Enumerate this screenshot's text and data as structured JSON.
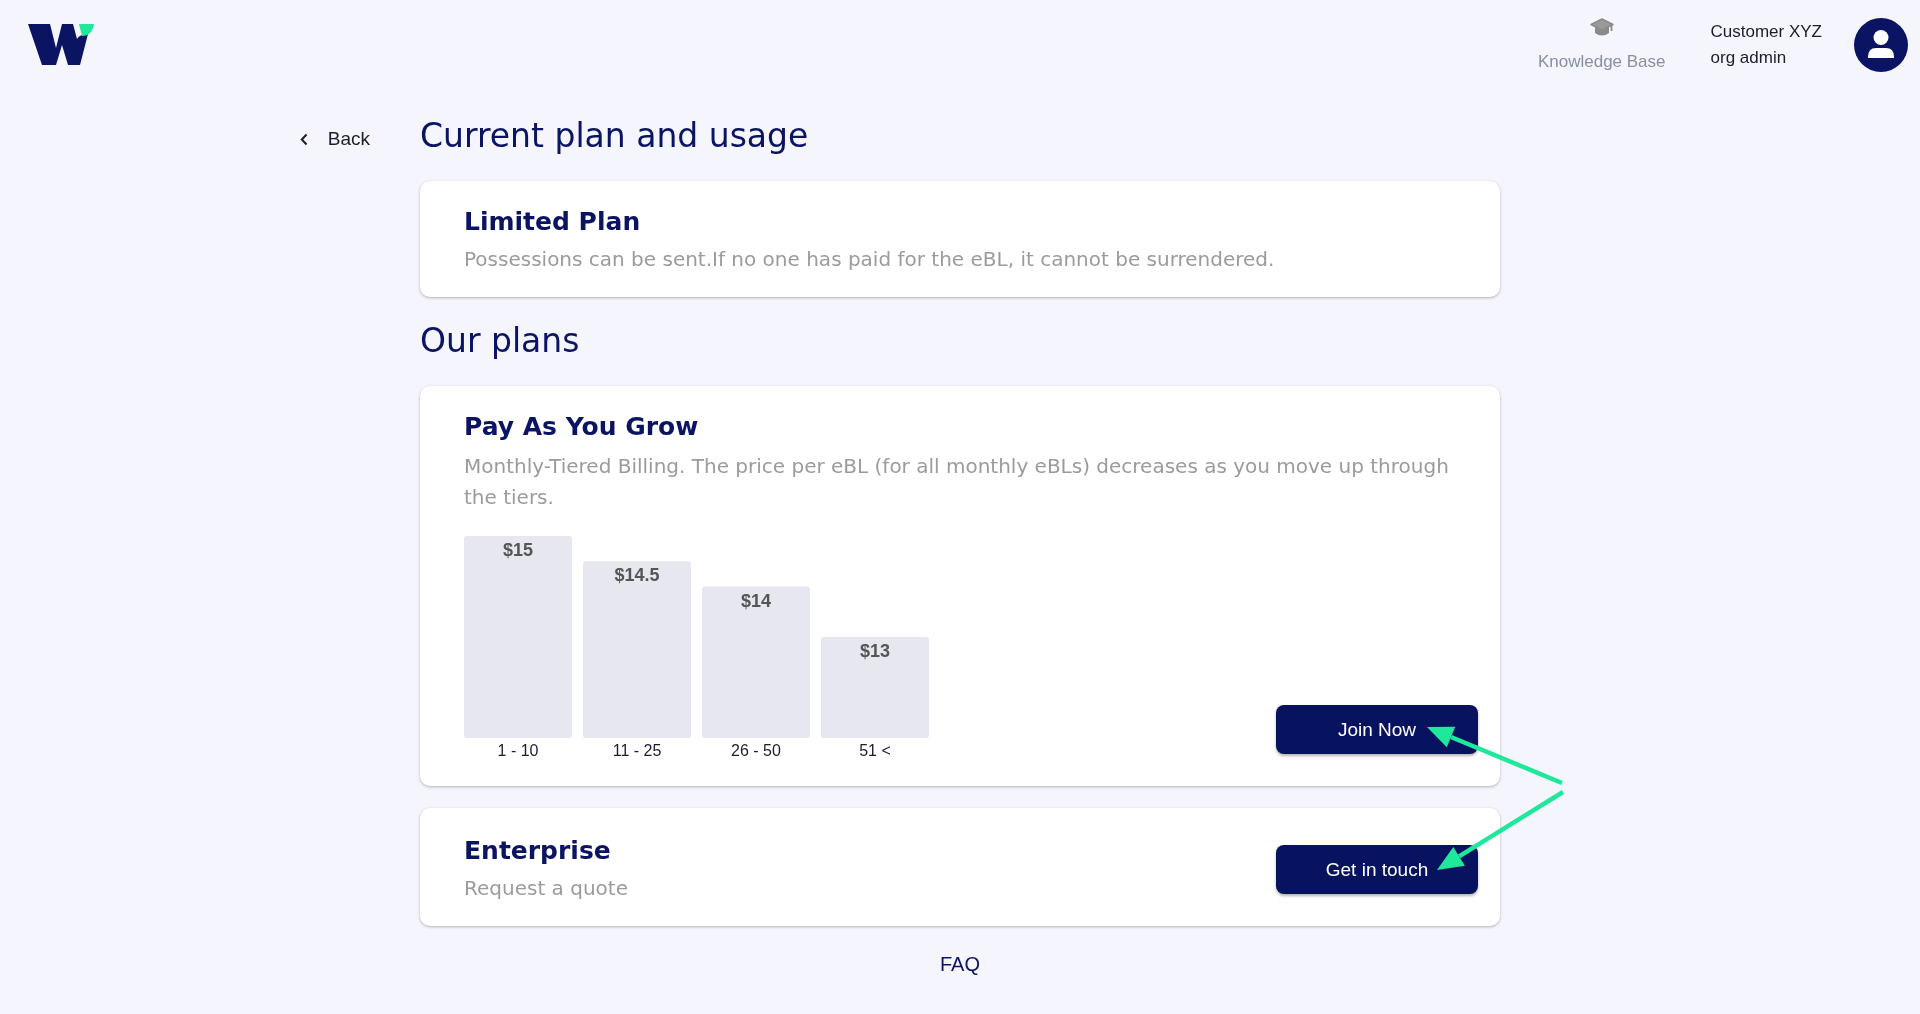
{
  "header": {
    "knowledge_base": {
      "label": "Knowledge Base"
    },
    "user": {
      "name": "Customer XYZ",
      "role": "org admin"
    }
  },
  "back": {
    "label": "Back"
  },
  "page_title": "Current plan and usage",
  "current_plan": {
    "title": "Limited Plan",
    "description": "Possessions can be sent.If no one has paid for the eBL, it cannot be surrendered."
  },
  "plans_heading": "Our plans",
  "plans": [
    {
      "kind": "tiered",
      "title": "Pay As You Grow",
      "description": "Monthly-Tiered Billing. The price per eBL (for all monthly eBLs) decreases as you move up through the tiers.",
      "chart_data": {
        "type": "bar",
        "categories": [
          "1 - 10",
          "11 - 25",
          "26 - 50",
          "51 <"
        ],
        "values": [
          15,
          14.5,
          14,
          13
        ],
        "ylim": [
          11,
          15
        ],
        "value_labels": [
          "$15",
          "$14.5",
          "$14",
          "$13"
        ]
      },
      "button": "Join Now"
    },
    {
      "kind": "quote",
      "title": "Enterprise",
      "description": "Request a quote",
      "button": "Get in touch"
    }
  ],
  "faq": "FAQ"
}
